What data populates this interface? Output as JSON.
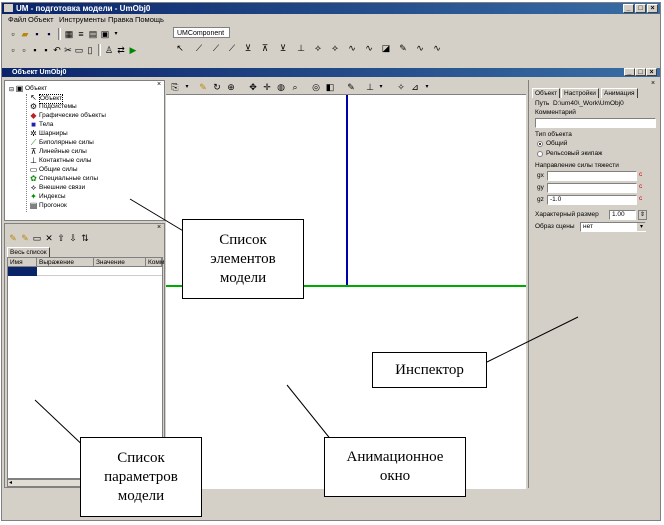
{
  "app": {
    "title": "UM - подготовка модели - UmObj0"
  },
  "menu": [
    "Файл",
    "Объект",
    "Инструменты",
    "Правка",
    "Помощь"
  ],
  "toolbar_tab": "UMComponent",
  "object_window": {
    "title": "Объект UmObj0"
  },
  "tree": {
    "root": "Объект",
    "items": [
      "Объект",
      "Подсистемы",
      "Графические объекты",
      "Тела",
      "Шарниры",
      "Биполярные силы",
      "Линейные силы",
      "Контактные силы",
      "Общие силы",
      "Специальные силы",
      "Внешние связи",
      "Индексы",
      "Прогонок"
    ]
  },
  "params": {
    "tab": "Весь список",
    "columns": [
      "Имя",
      "Выражение",
      "Значение",
      "Комм"
    ]
  },
  "inspector": {
    "tabs": [
      "Объект",
      "Настройки",
      "Анимация"
    ],
    "path_label": "Путь",
    "path_value": "D:\\um40\\_Work\\UmObj0",
    "comment_label": "Комментарий",
    "type_group": "Тип объекта",
    "type_options": [
      "Общий",
      "Рельсовый экипаж"
    ],
    "gravity_group": "Направление силы тяжести",
    "gx_label": "gx",
    "gy_label": "gy",
    "gz_label": "gz",
    "gz_value": "-1.0",
    "char_size_label": "Характерный размер",
    "char_size_value": "1.00",
    "scene_label": "Образ сцены",
    "scene_value": "нет"
  },
  "callouts": {
    "elements": "Список\nэлементов\nмодели",
    "inspector": "Инспектор",
    "params": "Список\nпараметров\nмодели",
    "animation": "Анимационное\nокно"
  },
  "colors": {
    "title_start": "#0a246a",
    "title_end": "#3a6ea5",
    "axis_blue": "#0000aa",
    "axis_green": "#00aa00"
  }
}
